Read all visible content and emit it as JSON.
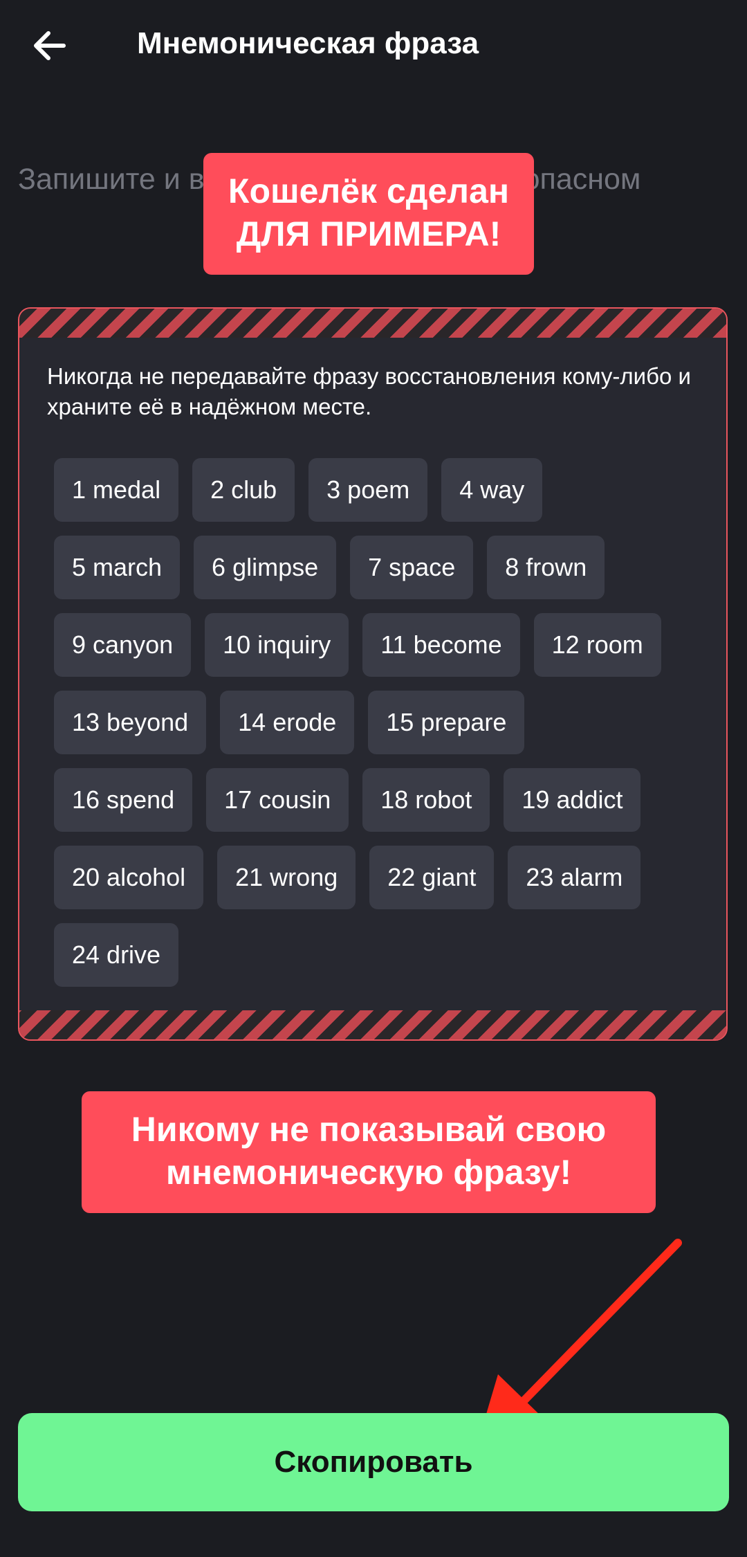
{
  "header": {
    "title": "Мнемоническая фраза",
    "back_icon": "arrow-left-icon"
  },
  "intro_text": "Запишите и                                                в правильном                                              е их в безопасном",
  "stickers": {
    "top": "Кошелёк сделан ДЛЯ ПРИМЕРА!",
    "bottom": "Никому не показывай свою мнемоническую фразу!"
  },
  "card": {
    "warning": "Никогда не передавайте фразу восстановления кому-либо и храните её в надёжном месте.",
    "words": [
      "1 medal",
      "2 club",
      "3 poem",
      "4 way",
      "5 march",
      "6 glimpse",
      "7 space",
      "8 frown",
      "9 canyon",
      "10 inquiry",
      "11 become",
      "12 room",
      "13 beyond",
      "14 erode",
      "15 prepare",
      "16 spend",
      "17 cousin",
      "18 robot",
      "19 addict",
      "20 alcohol",
      "21 wrong",
      "22 giant",
      "23 alarm",
      "24 drive"
    ]
  },
  "copy_button": {
    "label": "Скопировать"
  },
  "colors": {
    "background": "#1b1c21",
    "accent_red": "#ff4d5a",
    "button_green": "#6ff594",
    "chip": "#3a3c47"
  }
}
